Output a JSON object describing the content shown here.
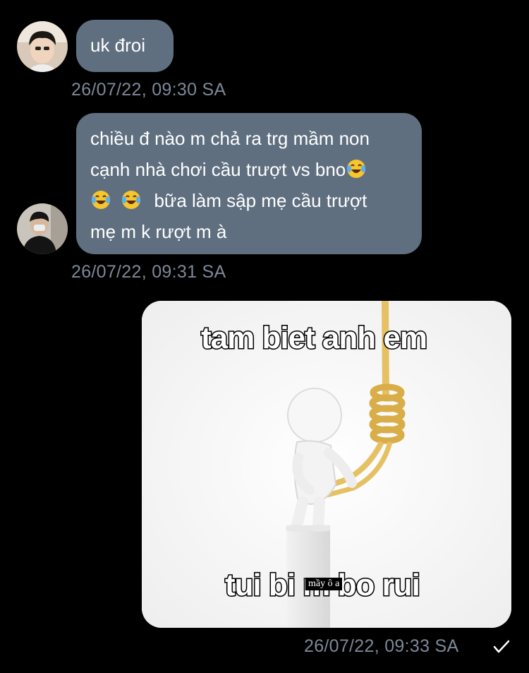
{
  "messages": [
    {
      "text": "uk đroi",
      "timestamp": "26/07/22, 09:30 SA"
    },
    {
      "lines": [
        "chiều đ nào m chả ra trg mầm non",
        "cạnh nhà chơi cầu trượt vs bno",
        "bữa làm sập mẹ cầu trượt",
        "mẹ m k rượt m à"
      ],
      "emoji": "face-with-tears-of-joy",
      "timestamp": "26/07/22, 09:31 SA"
    },
    {
      "image": {
        "top_text": "tam biet anh em",
        "bottom_text": "tui bi m bo rui",
        "subtitle": "mầy ô a"
      },
      "timestamp": "26/07/22, 09:33 SA",
      "status_icon": "check-icon"
    }
  ],
  "colors": {
    "background": "#000000",
    "bubble": "#5f6f80",
    "timestamp": "#7d8898",
    "rope": "#e8c56a"
  }
}
